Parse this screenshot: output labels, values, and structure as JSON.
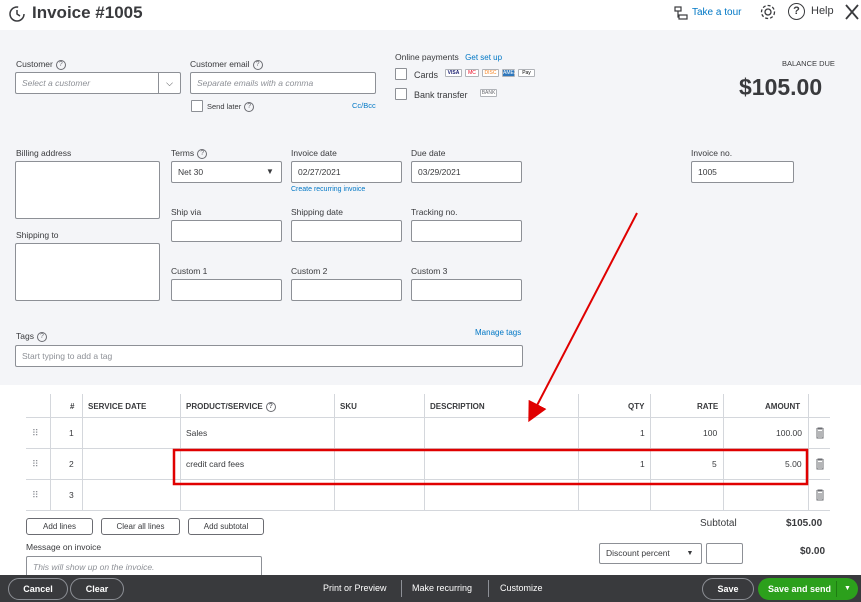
{
  "header": {
    "title": "Invoice #1005",
    "take_tour": "Take a tour",
    "help": "Help"
  },
  "customer": {
    "label": "Customer",
    "placeholder": "Select a customer"
  },
  "customer_email": {
    "label": "Customer email",
    "placeholder": "Separate emails with a comma",
    "send_later": "Send later",
    "cc_bcc": "Cc/Bcc"
  },
  "online_payments": {
    "label": "Online payments",
    "get_set_up": "Get set up",
    "cards": "Cards",
    "bank_transfer": "Bank transfer",
    "card_logos": [
      "VISA",
      "MC",
      "DISC",
      "AMEX",
      "Pay"
    ],
    "bank_logo": "BANK"
  },
  "balance": {
    "label": "BALANCE DUE",
    "amount": "$105.00"
  },
  "billing_address": {
    "label": "Billing address"
  },
  "shipping_to": {
    "label": "Shipping to"
  },
  "terms": {
    "label": "Terms",
    "value": "Net 30"
  },
  "invoice_date": {
    "label": "Invoice date",
    "value": "02/27/2021",
    "recurring_link": "Create recurring invoice"
  },
  "due_date": {
    "label": "Due date",
    "value": "03/29/2021"
  },
  "invoice_no": {
    "label": "Invoice no.",
    "value": "1005"
  },
  "ship_via": {
    "label": "Ship via"
  },
  "shipping_date": {
    "label": "Shipping date"
  },
  "tracking_no": {
    "label": "Tracking no."
  },
  "custom": {
    "c1": "Custom 1",
    "c2": "Custom 2",
    "c3": "Custom 3"
  },
  "tags": {
    "label": "Tags",
    "manage": "Manage tags",
    "placeholder": "Start typing to add a tag"
  },
  "table": {
    "columns": {
      "num": "#",
      "service_date": "SERVICE DATE",
      "product": "PRODUCT/SERVICE",
      "sku": "SKU",
      "description": "DESCRIPTION",
      "qty": "QTY",
      "rate": "RATE",
      "amount": "AMOUNT"
    },
    "rows": [
      {
        "num": "1",
        "product": "Sales",
        "qty": "1",
        "rate": "100",
        "amount": "100.00"
      },
      {
        "num": "2",
        "product": "credit card fees",
        "qty": "1",
        "rate": "5",
        "amount": "5.00"
      },
      {
        "num": "3",
        "product": "",
        "qty": "",
        "rate": "",
        "amount": ""
      }
    ]
  },
  "table_actions": {
    "add_lines": "Add lines",
    "clear_all": "Clear all lines",
    "add_subtotal": "Add subtotal"
  },
  "totals": {
    "subtotal_label": "Subtotal",
    "subtotal_value": "$105.00",
    "discount_label": "Discount percent",
    "discount_value": "$0.00"
  },
  "message": {
    "label": "Message on invoice",
    "placeholder": "This will show up on the invoice."
  },
  "footer": {
    "cancel": "Cancel",
    "clear": "Clear",
    "print_preview": "Print or Preview",
    "make_recurring": "Make recurring",
    "customize": "Customize",
    "save": "Save",
    "save_and_send": "Save and send"
  },
  "colors": {
    "accent_blue": "#0077c5",
    "green": "#2ca01c",
    "footer_bg": "#393a3d",
    "annotation_red": "#e00000"
  }
}
